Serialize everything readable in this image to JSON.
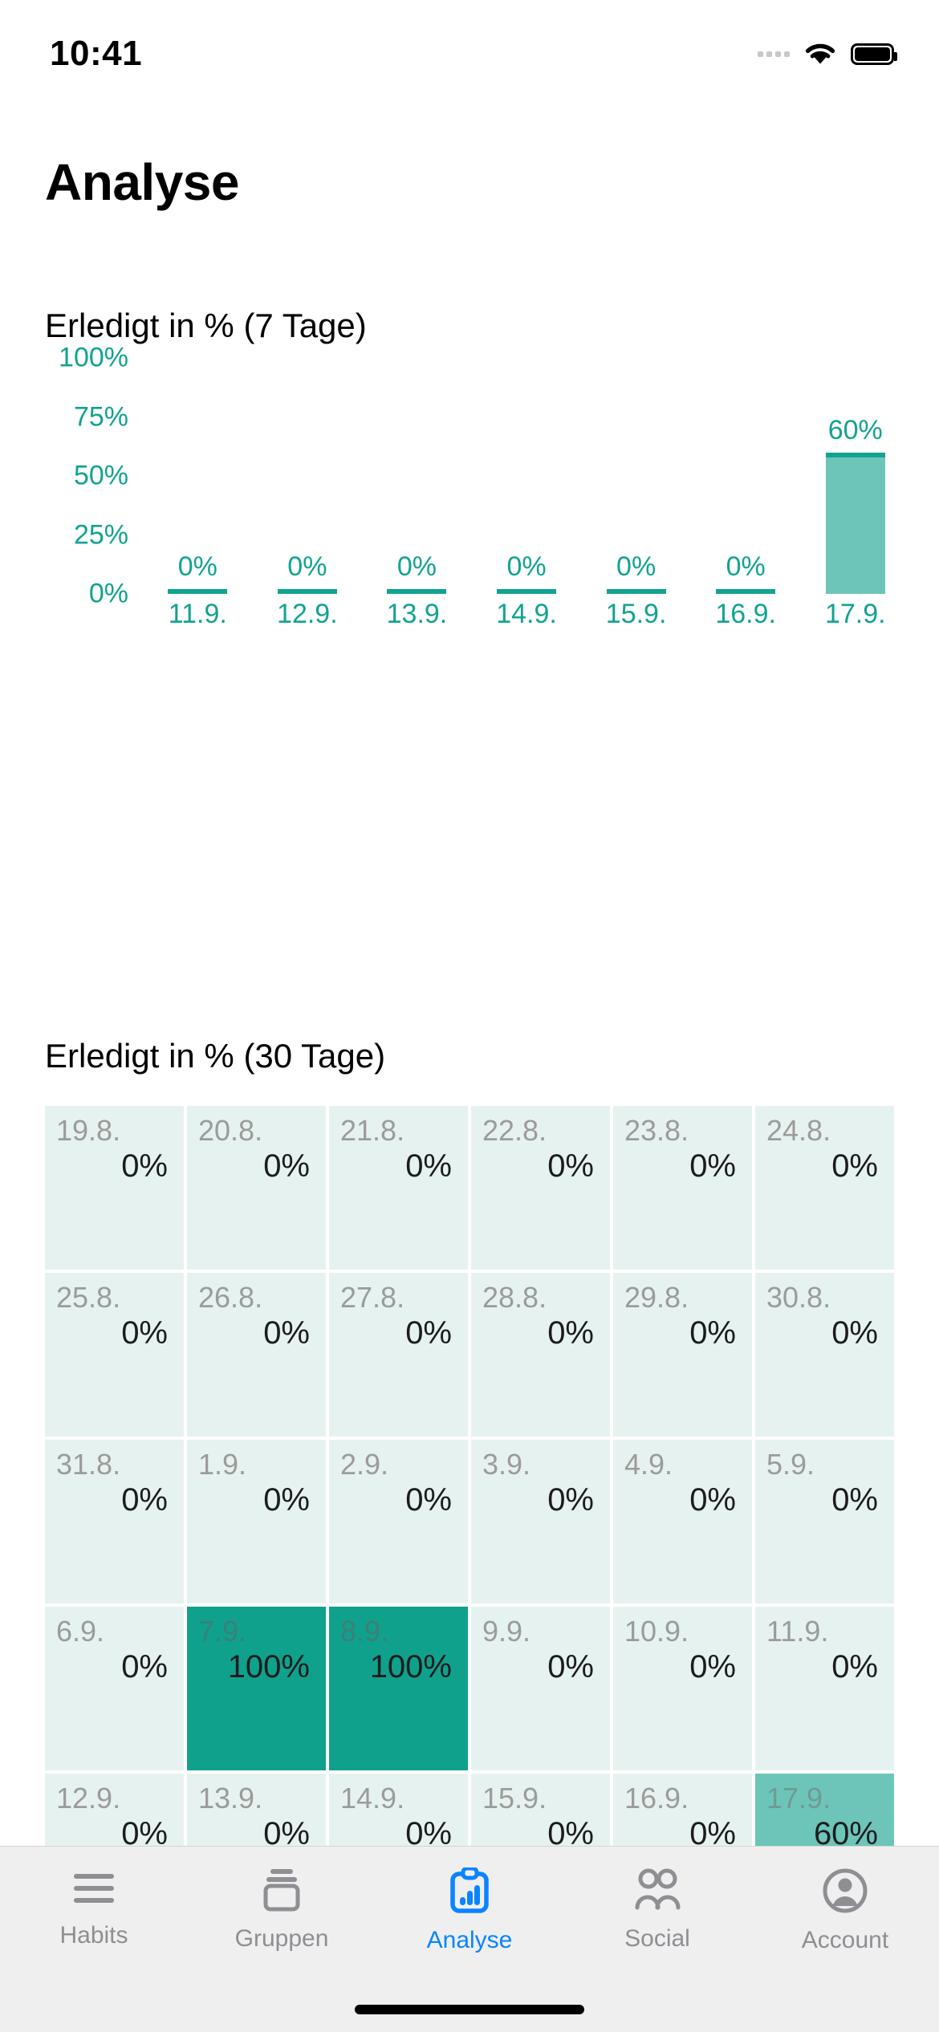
{
  "status_bar": {
    "time": "10:41",
    "signal_icon": "signal-dots-icon",
    "wifi_icon": "wifi-icon",
    "battery_icon": "battery-full-icon"
  },
  "header": {
    "title": "Analyse"
  },
  "sections": {
    "weekly_heading": "Erledigt in % (7 Tage)",
    "monthly_heading": "Erledigt in % (30 Tage)"
  },
  "colors": {
    "accent_teal": "#12a391",
    "bar_fill": "#6cc5b8",
    "cell_empty": "#e6f2ef",
    "cell_full": "#0fa18c",
    "cell_mid": "#6cc5b8",
    "tab_active": "#0a84ff",
    "tab_inactive": "#8e8e93"
  },
  "chart_data": {
    "type": "bar",
    "title": "Erledigt in % (7 Tage)",
    "xlabel": "",
    "ylabel": "",
    "ylim": [
      0,
      100
    ],
    "yticks": [
      "0%",
      "25%",
      "50%",
      "75%",
      "100%"
    ],
    "ytick_values": [
      0,
      25,
      50,
      75,
      100
    ],
    "grid": false,
    "legend": "none",
    "categories": [
      "11.9.",
      "12.9.",
      "13.9.",
      "14.9.",
      "15.9.",
      "16.9.",
      "17.9."
    ],
    "values": [
      0,
      0,
      0,
      0,
      0,
      0,
      60
    ],
    "value_labels": [
      "0%",
      "0%",
      "0%",
      "0%",
      "0%",
      "0%",
      "60%"
    ]
  },
  "heatmap": {
    "type": "heatmap",
    "title": "Erledigt in % (30 Tage)",
    "columns": 6,
    "rows": 5,
    "cells": [
      {
        "date": "19.8.",
        "value": "0%",
        "pct": 0,
        "level": "empty"
      },
      {
        "date": "20.8.",
        "value": "0%",
        "pct": 0,
        "level": "empty"
      },
      {
        "date": "21.8.",
        "value": "0%",
        "pct": 0,
        "level": "empty"
      },
      {
        "date": "22.8.",
        "value": "0%",
        "pct": 0,
        "level": "empty"
      },
      {
        "date": "23.8.",
        "value": "0%",
        "pct": 0,
        "level": "empty"
      },
      {
        "date": "24.8.",
        "value": "0%",
        "pct": 0,
        "level": "empty"
      },
      {
        "date": "25.8.",
        "value": "0%",
        "pct": 0,
        "level": "empty"
      },
      {
        "date": "26.8.",
        "value": "0%",
        "pct": 0,
        "level": "empty"
      },
      {
        "date": "27.8.",
        "value": "0%",
        "pct": 0,
        "level": "empty"
      },
      {
        "date": "28.8.",
        "value": "0%",
        "pct": 0,
        "level": "empty"
      },
      {
        "date": "29.8.",
        "value": "0%",
        "pct": 0,
        "level": "empty"
      },
      {
        "date": "30.8.",
        "value": "0%",
        "pct": 0,
        "level": "empty"
      },
      {
        "date": "31.8.",
        "value": "0%",
        "pct": 0,
        "level": "empty"
      },
      {
        "date": "1.9.",
        "value": "0%",
        "pct": 0,
        "level": "empty"
      },
      {
        "date": "2.9.",
        "value": "0%",
        "pct": 0,
        "level": "empty"
      },
      {
        "date": "3.9.",
        "value": "0%",
        "pct": 0,
        "level": "empty"
      },
      {
        "date": "4.9.",
        "value": "0%",
        "pct": 0,
        "level": "empty"
      },
      {
        "date": "5.9.",
        "value": "0%",
        "pct": 0,
        "level": "empty"
      },
      {
        "date": "6.9.",
        "value": "0%",
        "pct": 0,
        "level": "empty"
      },
      {
        "date": "7.9.",
        "value": "100%",
        "pct": 100,
        "level": "full"
      },
      {
        "date": "8.9.",
        "value": "100%",
        "pct": 100,
        "level": "full"
      },
      {
        "date": "9.9.",
        "value": "0%",
        "pct": 0,
        "level": "empty"
      },
      {
        "date": "10.9.",
        "value": "0%",
        "pct": 0,
        "level": "empty"
      },
      {
        "date": "11.9.",
        "value": "0%",
        "pct": 0,
        "level": "empty"
      },
      {
        "date": "12.9.",
        "value": "0%",
        "pct": 0,
        "level": "empty"
      },
      {
        "date": "13.9.",
        "value": "0%",
        "pct": 0,
        "level": "empty"
      },
      {
        "date": "14.9.",
        "value": "0%",
        "pct": 0,
        "level": "empty"
      },
      {
        "date": "15.9.",
        "value": "0%",
        "pct": 0,
        "level": "empty"
      },
      {
        "date": "16.9.",
        "value": "0%",
        "pct": 0,
        "level": "empty"
      },
      {
        "date": "17.9.",
        "value": "60%",
        "pct": 60,
        "level": "mid"
      }
    ]
  },
  "tabbar": {
    "items": [
      {
        "label": "Habits",
        "icon": "list-lines-icon",
        "active": false
      },
      {
        "label": "Gruppen",
        "icon": "stacked-box-icon",
        "active": false
      },
      {
        "label": "Analyse",
        "icon": "clipboard-chart-icon",
        "active": true
      },
      {
        "label": "Social",
        "icon": "people-group-icon",
        "active": false
      },
      {
        "label": "Account",
        "icon": "person-circle-icon",
        "active": false
      }
    ]
  }
}
